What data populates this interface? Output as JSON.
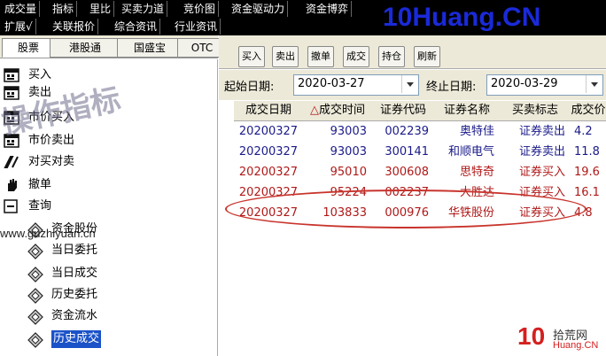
{
  "menu_row1": [
    "成交量",
    "指标",
    "里比",
    "买卖力道",
    "竞价图",
    "资金驱动力",
    "资金博弈"
  ],
  "menu_row2": [
    "扩展√",
    "关联报价",
    "综合资讯",
    "行业资讯"
  ],
  "brand": "10Huang.CN",
  "left_tabs": [
    "股票",
    "港股通",
    "国盛宝",
    "OTC"
  ],
  "tree": {
    "items": [
      {
        "label": "买入",
        "icon": "buy-icon"
      },
      {
        "label": "卖出",
        "icon": "sell-icon"
      },
      {
        "label": "市价买入",
        "icon": "market-buy-icon"
      },
      {
        "label": "市价卖出",
        "icon": "market-sell-icon"
      },
      {
        "label": "对买对卖",
        "icon": "pair-trade-icon"
      },
      {
        "label": "撤单",
        "icon": "hand-cancel-icon"
      },
      {
        "label": "查询",
        "icon": "minus-expander-icon"
      }
    ],
    "sub_items": [
      {
        "label": "资金股份",
        "icon": "query-node-icon"
      },
      {
        "label": "当日委托",
        "icon": "query-node-icon"
      },
      {
        "label": "当日成交",
        "icon": "query-node-icon"
      },
      {
        "label": "历史委托",
        "icon": "query-node-icon"
      },
      {
        "label": "资金流水",
        "icon": "query-node-icon"
      },
      {
        "label": "历史成交",
        "icon": "query-node-icon"
      }
    ],
    "selected": "历史成交"
  },
  "toolbar": [
    "买入",
    "卖出",
    "撤单",
    "成交",
    "持仓",
    "刷新"
  ],
  "date_filter": {
    "start_label": "起始日期:",
    "start_value": "2020-03-27",
    "end_label": "终止日期:",
    "end_value": "2020-03-29"
  },
  "table": {
    "columns": [
      "成交日期",
      "成交时间",
      "证券代码",
      "证券名称",
      "买卖标志",
      "成交价"
    ],
    "sort_marker": "△",
    "rows": [
      {
        "date": "20200327",
        "time": "93003",
        "code": "002239",
        "name": "奥特佳",
        "side": "证券卖出",
        "price": "4.2",
        "color": "blue"
      },
      {
        "date": "20200327",
        "time": "93003",
        "code": "300141",
        "name": "和顺电气",
        "side": "证券卖出",
        "price": "11.8",
        "color": "blue"
      },
      {
        "date": "20200327",
        "time": "95010",
        "code": "300608",
        "name": "思特奇",
        "side": "证券买入",
        "price": "19.6",
        "color": "red"
      },
      {
        "date": "20200327",
        "time": "95224",
        "code": "002237",
        "name": "大胜达",
        "side": "证券买入",
        "price": "16.1",
        "color": "red"
      },
      {
        "date": "20200327",
        "time": "103833",
        "code": "000976",
        "name": "华铁股份",
        "side": "证券买入",
        "price": "4.8",
        "color": "red"
      }
    ]
  },
  "watermarks": {
    "overlay": "操作指标",
    "site": "www.guzhiyuan.cn"
  },
  "logo": {
    "number": "10",
    "title": "拾荒网",
    "domain": "Huang.CN"
  },
  "colors": {
    "buy": "#b01818",
    "sell": "#1a1a8a",
    "highlight": "#c8342c",
    "selection": "#1b52c8"
  }
}
